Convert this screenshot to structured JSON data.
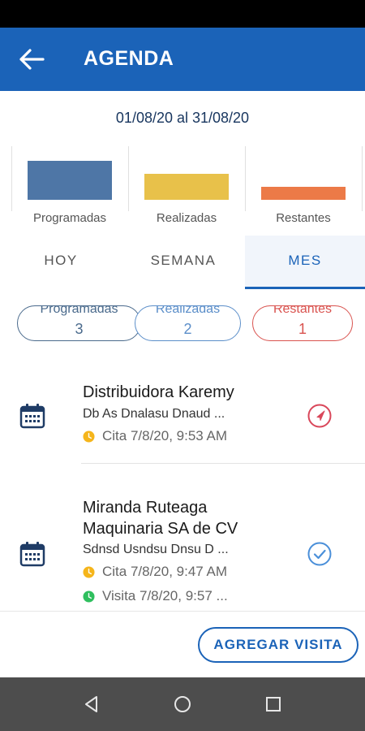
{
  "header": {
    "title": "AGENDA",
    "back_icon": "arrow-back-icon"
  },
  "date_range": "01/08/20 al 31/08/20",
  "summary_chart": {
    "items": [
      {
        "label": "Programadas",
        "value": 3,
        "color": "#4e76a6"
      },
      {
        "label": "Realizadas",
        "value": 2,
        "color": "#e8c14a"
      },
      {
        "label": "Restantes",
        "value": 1,
        "color": "#ec7a47"
      }
    ]
  },
  "tabs": [
    {
      "label": "HOY",
      "active": false
    },
    {
      "label": "SEMANA",
      "active": false
    },
    {
      "label": "MES",
      "active": true
    }
  ],
  "chips": [
    {
      "label": "Programadas",
      "count": "3",
      "color": "#4a6a8c"
    },
    {
      "label": "Realizadas",
      "count": "2",
      "color": "#5b8ec9"
    },
    {
      "label": "Restantes",
      "count": "1",
      "color": "#d9534f"
    }
  ],
  "visits": [
    {
      "title": "Distribuidora Karemy",
      "subtitle": "Db As Dnalasu Dnaud ...",
      "meta": [
        {
          "text": "Cita 7/8/20, 9:53 AM",
          "color": "#f5b51b"
        }
      ],
      "action_icon": "navigation-arrow-icon",
      "action_color": "#d9475a"
    },
    {
      "title_line1": "Miranda Ruteaga",
      "title_line2": "Maquinaria SA de CV",
      "subtitle": "Sdnsd Usndsu Dnsu D ...",
      "meta": [
        {
          "text": "Cita 7/8/20, 9:47 AM",
          "color": "#f5b51b"
        },
        {
          "text": "Visita 7/8/20, 9:57 ...",
          "color": "#2fbf5e"
        }
      ],
      "action_icon": "check-circle-icon",
      "action_color": "#4a8fd9"
    }
  ],
  "add_visit_label": "AGREGAR VISITA",
  "nav": {
    "back": "nav-back-icon",
    "home": "nav-home-icon",
    "recents": "nav-recents-icon"
  },
  "colors": {
    "primary": "#1b63b8",
    "nav_bar": "#4d4d4d",
    "calendar_icon": "#1f3c66"
  }
}
